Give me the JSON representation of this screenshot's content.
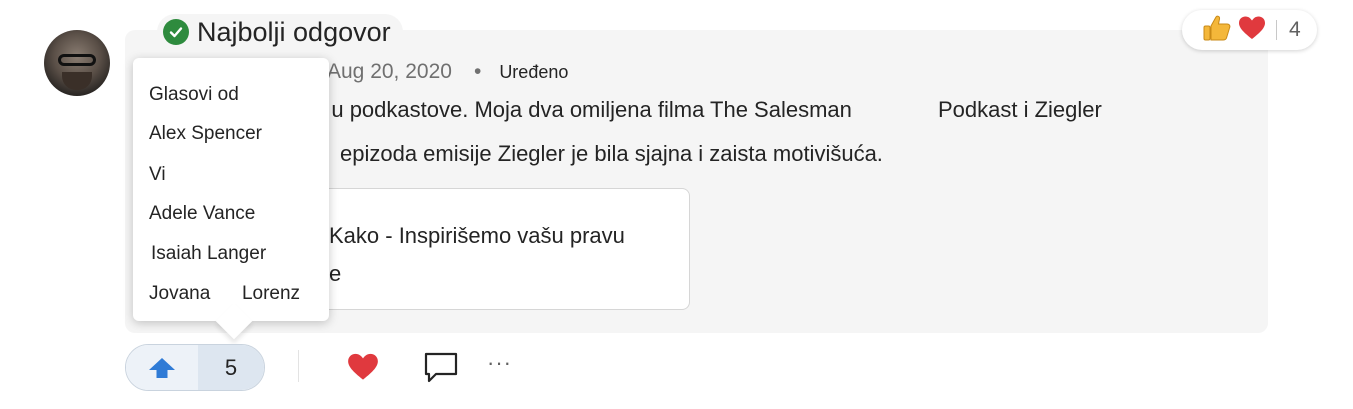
{
  "badge": {
    "label": "Najbolji odgovor"
  },
  "reactions": {
    "count": "4",
    "icons": [
      "thumbs-up-icon",
      "heart-icon"
    ]
  },
  "post": {
    "date": "Aug 20, 2020",
    "separator": "•",
    "edited": "Uređeno",
    "line1": "g u podkastove. Moja dva omiljena filma The Salesman",
    "line1b": "Podkast i Ziegler",
    "line2": "epizoda emisije Ziegler je bila sjajna i zaista motivišuća."
  },
  "link_card": {
    "line1": "Kako  -  Inspirišemo vašu pravu",
    "line2": "e"
  },
  "votes_popup": {
    "heading": "Glasovi od",
    "voters": [
      "Alex Spencer",
      "Vi",
      "Adele Vance",
      "Isaiah Langer",
      "Jovana      Lorenz"
    ]
  },
  "actions": {
    "vote_count": "5",
    "more_label": "···"
  },
  "colors": {
    "accent_blue": "#2f7bd6",
    "heart_red": "#e0393e",
    "best_green": "#2e8b3e",
    "card_bg": "#f5f5f5"
  }
}
